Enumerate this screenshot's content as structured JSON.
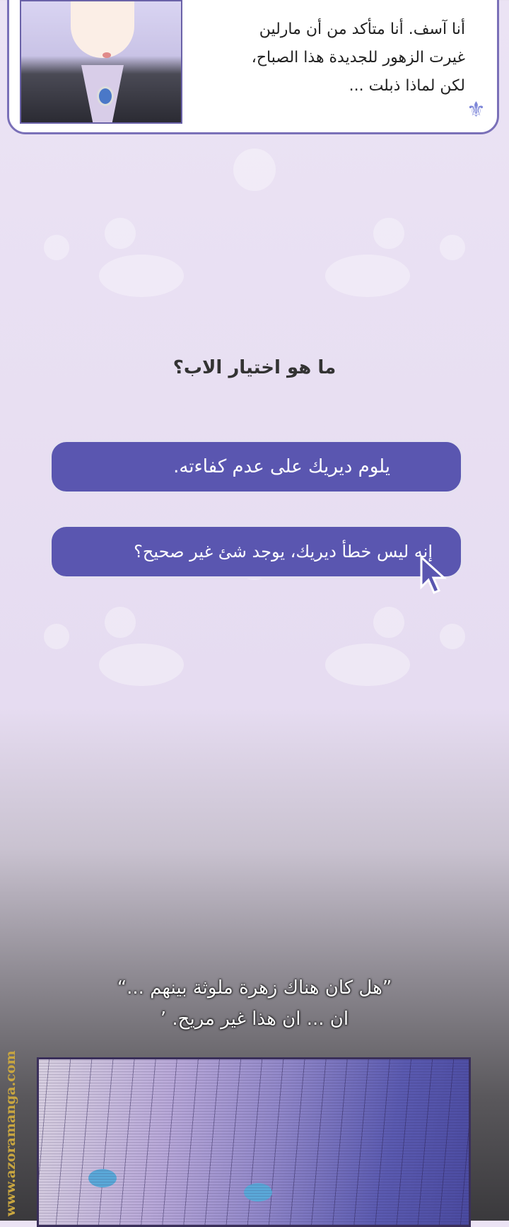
{
  "dialog": {
    "lines": [
      "أنا آسف. أنا متأكد من أن مارلين",
      "غيرت الزهور للجديدة هذا الصباح،",
      "لكن لماذا ذبلت ..."
    ],
    "ornament_icon": "fleur-de-lis-icon"
  },
  "choice": {
    "question": "ما هو اختيار الاب؟",
    "options": [
      {
        "label": "يلوم ديريك على عدم كفاءته."
      },
      {
        "label": "إنه ليس خطأ ديريك، يوجد شئ غير صحيح؟"
      }
    ],
    "accent": "#5a56b0",
    "hovered_option": 2
  },
  "caption": {
    "lines": [
      "”هل كان هناك زهرة ملوثة بينهم ...“",
      "ان ... ان هذا غير مريح. ’"
    ]
  },
  "watermark": "www.azoramanga.com"
}
